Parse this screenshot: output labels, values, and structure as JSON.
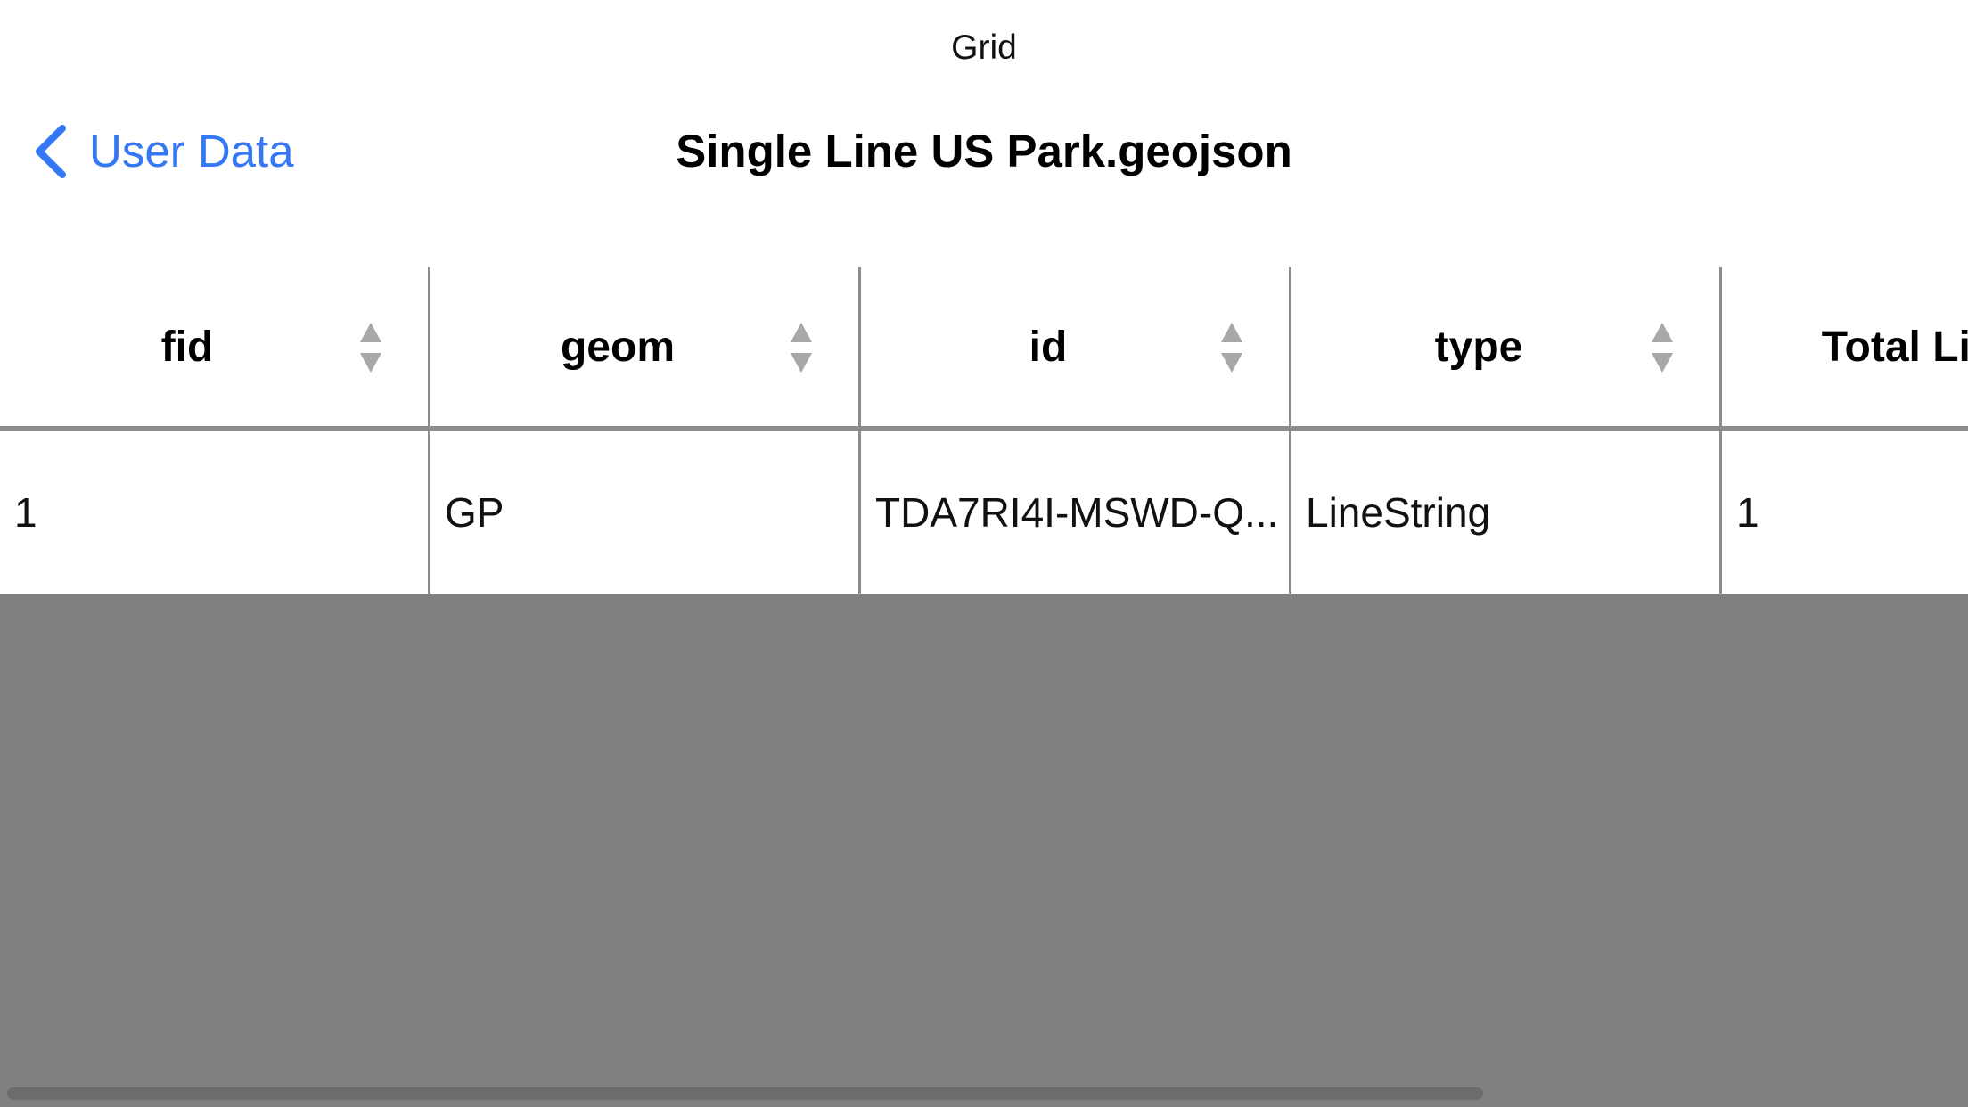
{
  "status_bar": {
    "title": "Grid"
  },
  "nav": {
    "back_label": "User Data",
    "title": "Single Line US Park.geojson"
  },
  "grid": {
    "columns": [
      "fid",
      "geom",
      "id",
      "type",
      "Total Lin"
    ],
    "rows": [
      [
        "1",
        "GP",
        "TDA7RI4I-MSWD-Q...",
        "LineString",
        "1"
      ]
    ]
  },
  "icons": {
    "back": "chevron-left-icon",
    "sort": "sort-updown-icon"
  },
  "colors": {
    "accent": "#3478f6",
    "divider": "#8c8c8c",
    "empty_area": "#808080",
    "sort_icon": "#a8a8a8"
  }
}
